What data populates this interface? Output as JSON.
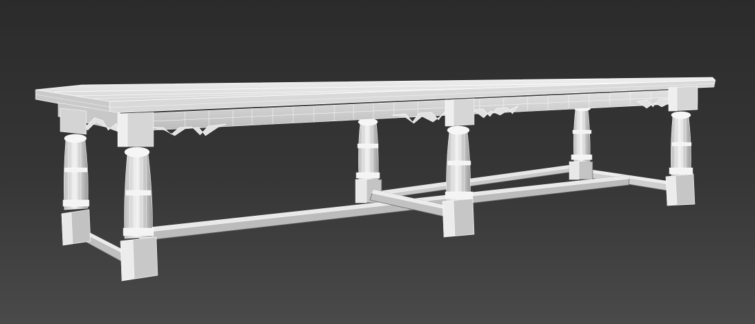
{
  "scene": {
    "subject": "refectory-table",
    "render_style": "wireframe-shaded",
    "colors": {
      "background_top": "#2b2b2b",
      "background_bottom": "#4a4a4a",
      "surface_light": "#e9e9e9",
      "surface_mid": "#cfcfcf",
      "surface_dark": "#9c9c9c",
      "wire": "#ffffff",
      "edge": "#5a5a5a"
    }
  }
}
